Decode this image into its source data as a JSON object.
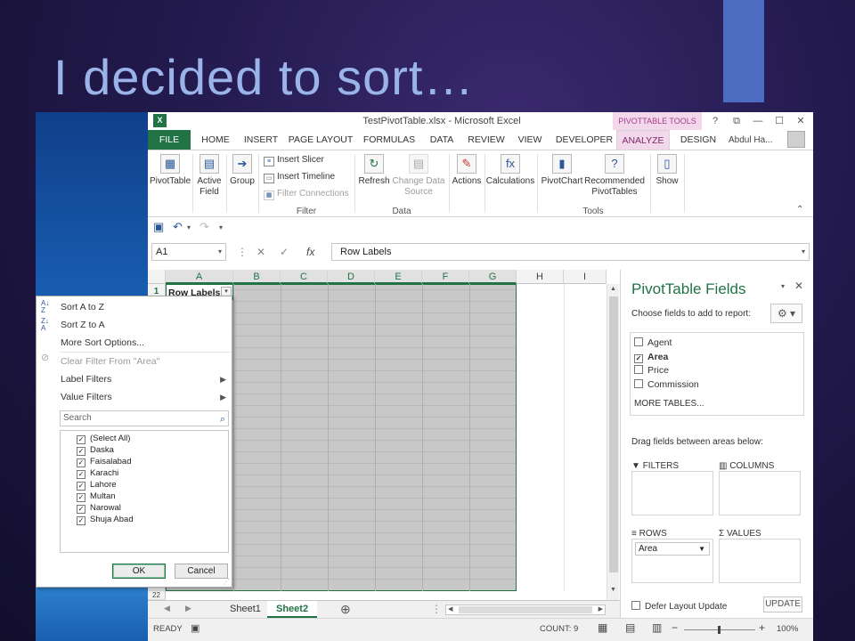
{
  "slide": {
    "title": "I decided to sort…"
  },
  "window": {
    "title": "TestPivotTable.xlsx - Microsoft Excel",
    "context_tools": "PIVOTTABLE TOOLS",
    "help": "?",
    "restore": "⧉",
    "minimize": "—",
    "maximize": "☐",
    "close": "✕",
    "user_name": "Abdul Ha..."
  },
  "tabs": [
    "FILE",
    "HOME",
    "INSERT",
    "PAGE LAYOUT",
    "FORMULAS",
    "DATA",
    "REVIEW",
    "VIEW",
    "DEVELOPER",
    "ANALYZE",
    "DESIGN"
  ],
  "ribbon": {
    "pivottable": "PivotTable",
    "active_field": "Active Field",
    "group": "Group",
    "insert_slicer": "Insert Slicer",
    "insert_timeline": "Insert Timeline",
    "filter_connections": "Filter Connections",
    "filter_label": "Filter",
    "refresh": "Refresh",
    "change_data_source": "Change Data Source",
    "data_label": "Data",
    "actions": "Actions",
    "calculations": "Calculations",
    "pivotchart": "PivotChart",
    "recommended": "Recommended PivotTables",
    "tools_label": "Tools",
    "show": "Show"
  },
  "formula_bar": {
    "name_box": "A1",
    "fx": "fx",
    "value": "Row Labels"
  },
  "columns": [
    "A",
    "B",
    "C",
    "D",
    "E",
    "F",
    "G",
    "H",
    "I"
  ],
  "rows": [
    "1",
    "22"
  ],
  "cell_a1": "Row Labels",
  "filter_menu": {
    "sort_az": "Sort A to Z",
    "sort_za": "Sort Z to A",
    "more_sort": "More Sort Options...",
    "clear_filter": "Clear Filter From \"Area\"",
    "label_filters": "Label Filters",
    "value_filters": "Value Filters",
    "search_placeholder": "Search",
    "items": [
      "(Select All)",
      "Daska",
      "Faisalabad",
      "Karachi",
      "Lahore",
      "Multan",
      "Narowal",
      "Shuja Abad"
    ],
    "ok": "OK",
    "cancel": "Cancel"
  },
  "sheets": {
    "sheet1": "Sheet1",
    "sheet2": "Sheet2"
  },
  "status": {
    "ready": "READY",
    "count": "COUNT: 9",
    "zoom": "100%"
  },
  "pivot_pane": {
    "title": "PivotTable Fields",
    "choose": "Choose fields to add to report:",
    "fields": [
      {
        "name": "Agent",
        "checked": false
      },
      {
        "name": "Area",
        "checked": true
      },
      {
        "name": "Price",
        "checked": false
      },
      {
        "name": "Commission",
        "checked": false
      }
    ],
    "more_tables": "MORE TABLES...",
    "drag": "Drag fields between areas below:",
    "filters": "FILTERS",
    "columns": "COLUMNS",
    "rows": "ROWS",
    "values": "VALUES",
    "rows_item": "Area",
    "defer": "Defer Layout Update",
    "update": "UPDATE"
  }
}
